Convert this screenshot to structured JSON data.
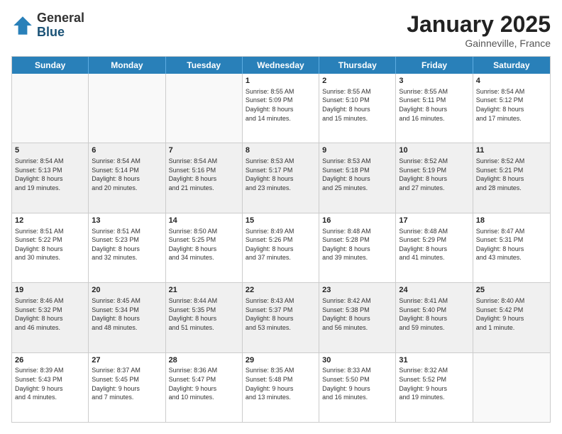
{
  "logo": {
    "general": "General",
    "blue": "Blue"
  },
  "header": {
    "month": "January 2025",
    "location": "Gainneville, France"
  },
  "weekdays": [
    "Sunday",
    "Monday",
    "Tuesday",
    "Wednesday",
    "Thursday",
    "Friday",
    "Saturday"
  ],
  "rows": [
    [
      {
        "day": "",
        "info": "",
        "empty": true
      },
      {
        "day": "",
        "info": "",
        "empty": true
      },
      {
        "day": "",
        "info": "",
        "empty": true
      },
      {
        "day": "1",
        "info": "Sunrise: 8:55 AM\nSunset: 5:09 PM\nDaylight: 8 hours\nand 14 minutes.",
        "empty": false
      },
      {
        "day": "2",
        "info": "Sunrise: 8:55 AM\nSunset: 5:10 PM\nDaylight: 8 hours\nand 15 minutes.",
        "empty": false
      },
      {
        "day": "3",
        "info": "Sunrise: 8:55 AM\nSunset: 5:11 PM\nDaylight: 8 hours\nand 16 minutes.",
        "empty": false
      },
      {
        "day": "4",
        "info": "Sunrise: 8:54 AM\nSunset: 5:12 PM\nDaylight: 8 hours\nand 17 minutes.",
        "empty": false
      }
    ],
    [
      {
        "day": "5",
        "info": "Sunrise: 8:54 AM\nSunset: 5:13 PM\nDaylight: 8 hours\nand 19 minutes.",
        "empty": false
      },
      {
        "day": "6",
        "info": "Sunrise: 8:54 AM\nSunset: 5:14 PM\nDaylight: 8 hours\nand 20 minutes.",
        "empty": false
      },
      {
        "day": "7",
        "info": "Sunrise: 8:54 AM\nSunset: 5:16 PM\nDaylight: 8 hours\nand 21 minutes.",
        "empty": false
      },
      {
        "day": "8",
        "info": "Sunrise: 8:53 AM\nSunset: 5:17 PM\nDaylight: 8 hours\nand 23 minutes.",
        "empty": false
      },
      {
        "day": "9",
        "info": "Sunrise: 8:53 AM\nSunset: 5:18 PM\nDaylight: 8 hours\nand 25 minutes.",
        "empty": false
      },
      {
        "day": "10",
        "info": "Sunrise: 8:52 AM\nSunset: 5:19 PM\nDaylight: 8 hours\nand 27 minutes.",
        "empty": false
      },
      {
        "day": "11",
        "info": "Sunrise: 8:52 AM\nSunset: 5:21 PM\nDaylight: 8 hours\nand 28 minutes.",
        "empty": false
      }
    ],
    [
      {
        "day": "12",
        "info": "Sunrise: 8:51 AM\nSunset: 5:22 PM\nDaylight: 8 hours\nand 30 minutes.",
        "empty": false
      },
      {
        "day": "13",
        "info": "Sunrise: 8:51 AM\nSunset: 5:23 PM\nDaylight: 8 hours\nand 32 minutes.",
        "empty": false
      },
      {
        "day": "14",
        "info": "Sunrise: 8:50 AM\nSunset: 5:25 PM\nDaylight: 8 hours\nand 34 minutes.",
        "empty": false
      },
      {
        "day": "15",
        "info": "Sunrise: 8:49 AM\nSunset: 5:26 PM\nDaylight: 8 hours\nand 37 minutes.",
        "empty": false
      },
      {
        "day": "16",
        "info": "Sunrise: 8:48 AM\nSunset: 5:28 PM\nDaylight: 8 hours\nand 39 minutes.",
        "empty": false
      },
      {
        "day": "17",
        "info": "Sunrise: 8:48 AM\nSunset: 5:29 PM\nDaylight: 8 hours\nand 41 minutes.",
        "empty": false
      },
      {
        "day": "18",
        "info": "Sunrise: 8:47 AM\nSunset: 5:31 PM\nDaylight: 8 hours\nand 43 minutes.",
        "empty": false
      }
    ],
    [
      {
        "day": "19",
        "info": "Sunrise: 8:46 AM\nSunset: 5:32 PM\nDaylight: 8 hours\nand 46 minutes.",
        "empty": false
      },
      {
        "day": "20",
        "info": "Sunrise: 8:45 AM\nSunset: 5:34 PM\nDaylight: 8 hours\nand 48 minutes.",
        "empty": false
      },
      {
        "day": "21",
        "info": "Sunrise: 8:44 AM\nSunset: 5:35 PM\nDaylight: 8 hours\nand 51 minutes.",
        "empty": false
      },
      {
        "day": "22",
        "info": "Sunrise: 8:43 AM\nSunset: 5:37 PM\nDaylight: 8 hours\nand 53 minutes.",
        "empty": false
      },
      {
        "day": "23",
        "info": "Sunrise: 8:42 AM\nSunset: 5:38 PM\nDaylight: 8 hours\nand 56 minutes.",
        "empty": false
      },
      {
        "day": "24",
        "info": "Sunrise: 8:41 AM\nSunset: 5:40 PM\nDaylight: 8 hours\nand 59 minutes.",
        "empty": false
      },
      {
        "day": "25",
        "info": "Sunrise: 8:40 AM\nSunset: 5:42 PM\nDaylight: 9 hours\nand 1 minute.",
        "empty": false
      }
    ],
    [
      {
        "day": "26",
        "info": "Sunrise: 8:39 AM\nSunset: 5:43 PM\nDaylight: 9 hours\nand 4 minutes.",
        "empty": false
      },
      {
        "day": "27",
        "info": "Sunrise: 8:37 AM\nSunset: 5:45 PM\nDaylight: 9 hours\nand 7 minutes.",
        "empty": false
      },
      {
        "day": "28",
        "info": "Sunrise: 8:36 AM\nSunset: 5:47 PM\nDaylight: 9 hours\nand 10 minutes.",
        "empty": false
      },
      {
        "day": "29",
        "info": "Sunrise: 8:35 AM\nSunset: 5:48 PM\nDaylight: 9 hours\nand 13 minutes.",
        "empty": false
      },
      {
        "day": "30",
        "info": "Sunrise: 8:33 AM\nSunset: 5:50 PM\nDaylight: 9 hours\nand 16 minutes.",
        "empty": false
      },
      {
        "day": "31",
        "info": "Sunrise: 8:32 AM\nSunset: 5:52 PM\nDaylight: 9 hours\nand 19 minutes.",
        "empty": false
      },
      {
        "day": "",
        "info": "",
        "empty": true
      }
    ]
  ]
}
